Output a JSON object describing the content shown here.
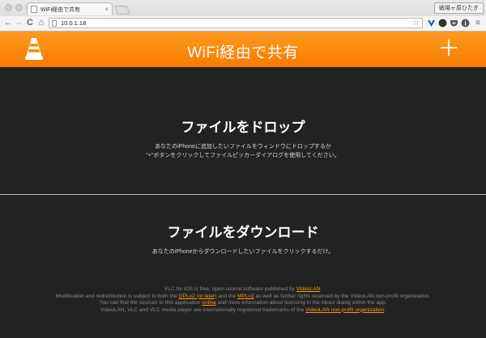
{
  "browser": {
    "tab_title": "WiFi経由で共有",
    "tab_close": "×",
    "profile_name": "戦場ヶ原ひたぎ",
    "url": "10.0.1.18",
    "nav": {
      "back": "←",
      "forward": "→",
      "reload": "C",
      "home": "⌂"
    },
    "bookmark_star": "☆",
    "menu": "≡"
  },
  "header": {
    "title": "WiFi経由で共有",
    "accent_color": "#ff8800"
  },
  "drop_section": {
    "heading": "ファイルをドロップ",
    "line1": "あなたのiPhoneに追加したいファイルをウィンドウにドロップするか",
    "line2": "\"+\"ボタンをクリックしてファイルピッカーダイアログを使用してください。"
  },
  "download_section": {
    "heading": "ファイルをダウンロード",
    "line1": "あなたのiPhoneからダウンロードしたいファイルをクリックするだけ。"
  },
  "footer": {
    "l1_a": "VLC for iOS is free, open-source software published by ",
    "l1_link": "VideoLAN",
    "l1_b": ".",
    "l2_a": "Modification and redistribution is subject to both the ",
    "l2_link1": "GPLv2 (or later)",
    "l2_b": " and the ",
    "l2_link2": "MPLv2",
    "l2_c": " as well as further rights reserved by the VideoLAN non-profit organization.",
    "l3_a": "You can find the sources to this application ",
    "l3_link": "online",
    "l3_b": " and more information about licensing in the About dialog within the app.",
    "l4_a": "VideoLAN, VLC and VLC media player are internationally registered trademarks of the ",
    "l4_link": "VideoLAN non-profit organization",
    "l4_b": "."
  }
}
